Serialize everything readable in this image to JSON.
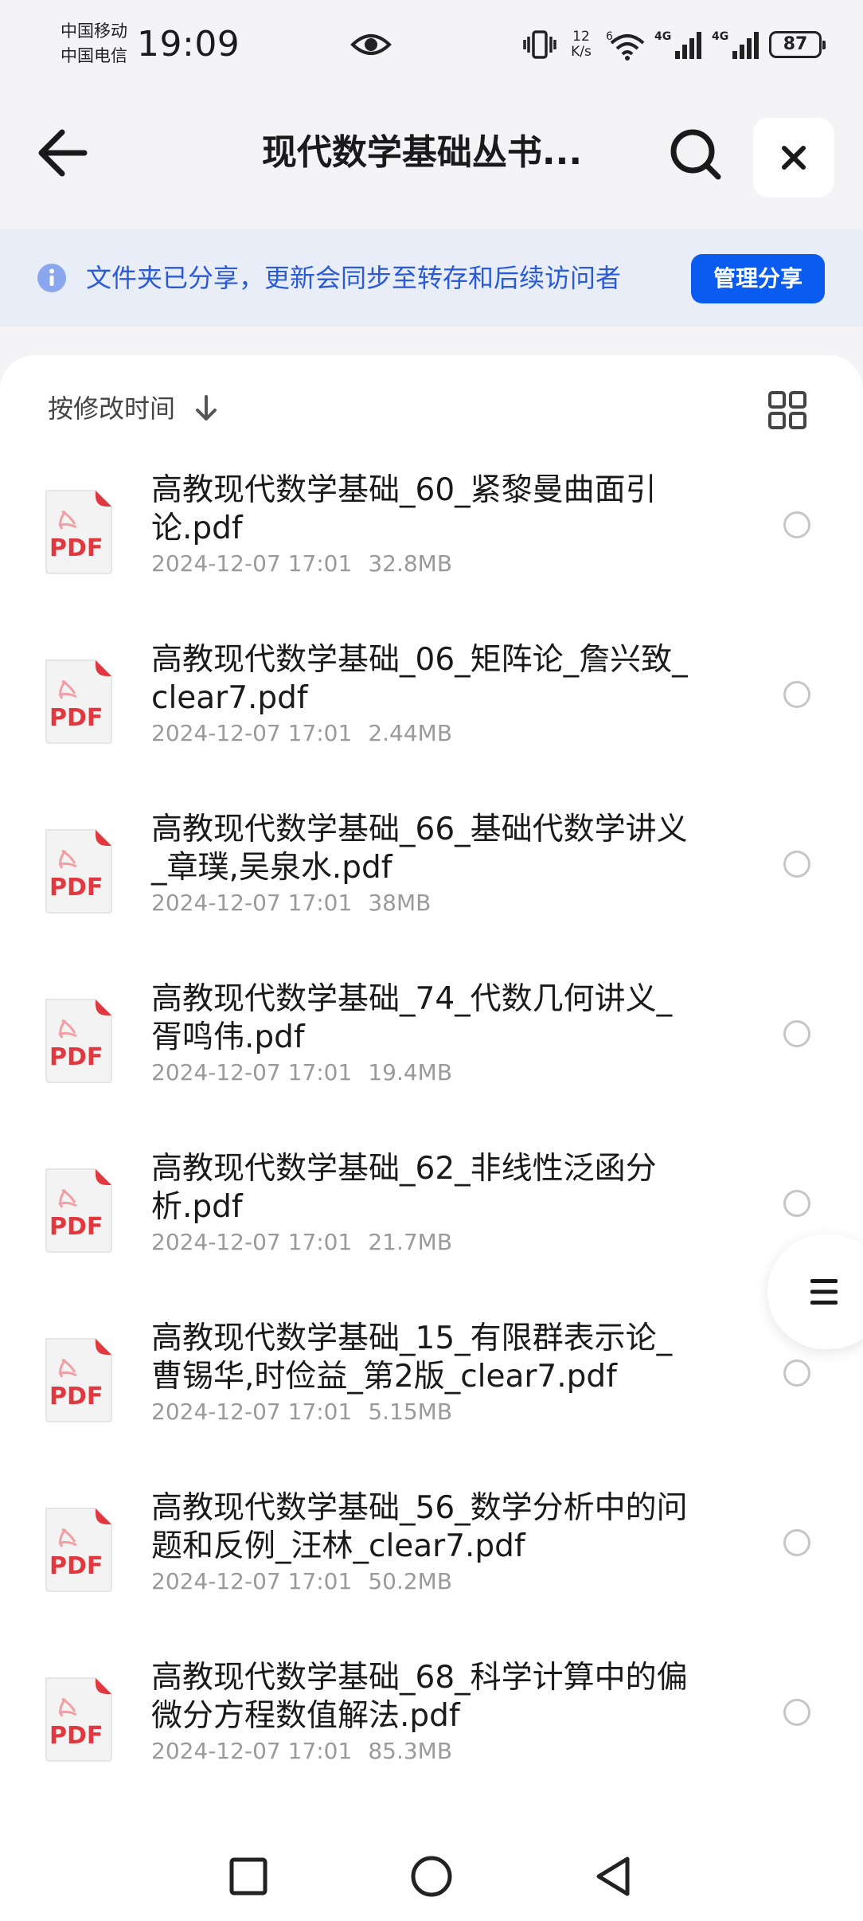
{
  "status_bar": {
    "carrier_1": "中国移动",
    "carrier_2": "中国电信",
    "time": "19:09",
    "speed_value": "12",
    "speed_unit": "K/s",
    "network_1": "4G",
    "network_2": "4G",
    "wifi_badge": "6",
    "battery": "87"
  },
  "header": {
    "title": "现代数学基础丛书..."
  },
  "share_banner": {
    "text": "文件夹已分享，更新会同步至转存和后续访问者",
    "manage_button": "管理分享"
  },
  "sort": {
    "label": "按修改时间"
  },
  "files": [
    {
      "name": "高教现代数学基础_60_紧黎曼曲面引论.pdf",
      "date": "2024-12-07 17:01",
      "size": "32.8MB"
    },
    {
      "name": "高教现代数学基础_06_矩阵论_詹兴致_clear7.pdf",
      "date": "2024-12-07 17:01",
      "size": "2.44MB"
    },
    {
      "name": "高教现代数学基础_66_基础代数学讲义_章璞,吴泉水.pdf",
      "date": "2024-12-07 17:01",
      "size": "38MB"
    },
    {
      "name": "高教现代数学基础_74_代数几何讲义_胥鸣伟.pdf",
      "date": "2024-12-07 17:01",
      "size": "19.4MB"
    },
    {
      "name": "高教现代数学基础_62_非线性泛函分析.pdf",
      "date": "2024-12-07 17:01",
      "size": "21.7MB"
    },
    {
      "name": "高教现代数学基础_15_有限群表示论_曹锡华,时俭益_第2版_clear7.pdf",
      "date": "2024-12-07 17:01",
      "size": "5.15MB"
    },
    {
      "name": "高教现代数学基础_56_数学分析中的问题和反例_汪林_clear7.pdf",
      "date": "2024-12-07 17:01",
      "size": "50.2MB"
    },
    {
      "name": "高教现代数学基础_68_科学计算中的偏微分方程数值解法.pdf",
      "date": "2024-12-07 17:01",
      "size": "85.3MB"
    }
  ],
  "file_icon_label": "PDF",
  "colors": {
    "accent": "#0a5bf0",
    "banner_bg": "#e9edf8",
    "banner_text": "#2a5bd6",
    "pdf_red": "#e0383e",
    "page_bg": "#f4f4f6"
  },
  "icons": {
    "header": [
      "back-arrow-icon",
      "search-icon",
      "close-icon"
    ],
    "banner": "info-icon",
    "sort": "arrow-down-icon",
    "view": "grid-view-icon",
    "floating": "menu-icon",
    "nav": [
      "square-recent-icon",
      "circle-home-icon",
      "triangle-back-icon"
    ]
  }
}
